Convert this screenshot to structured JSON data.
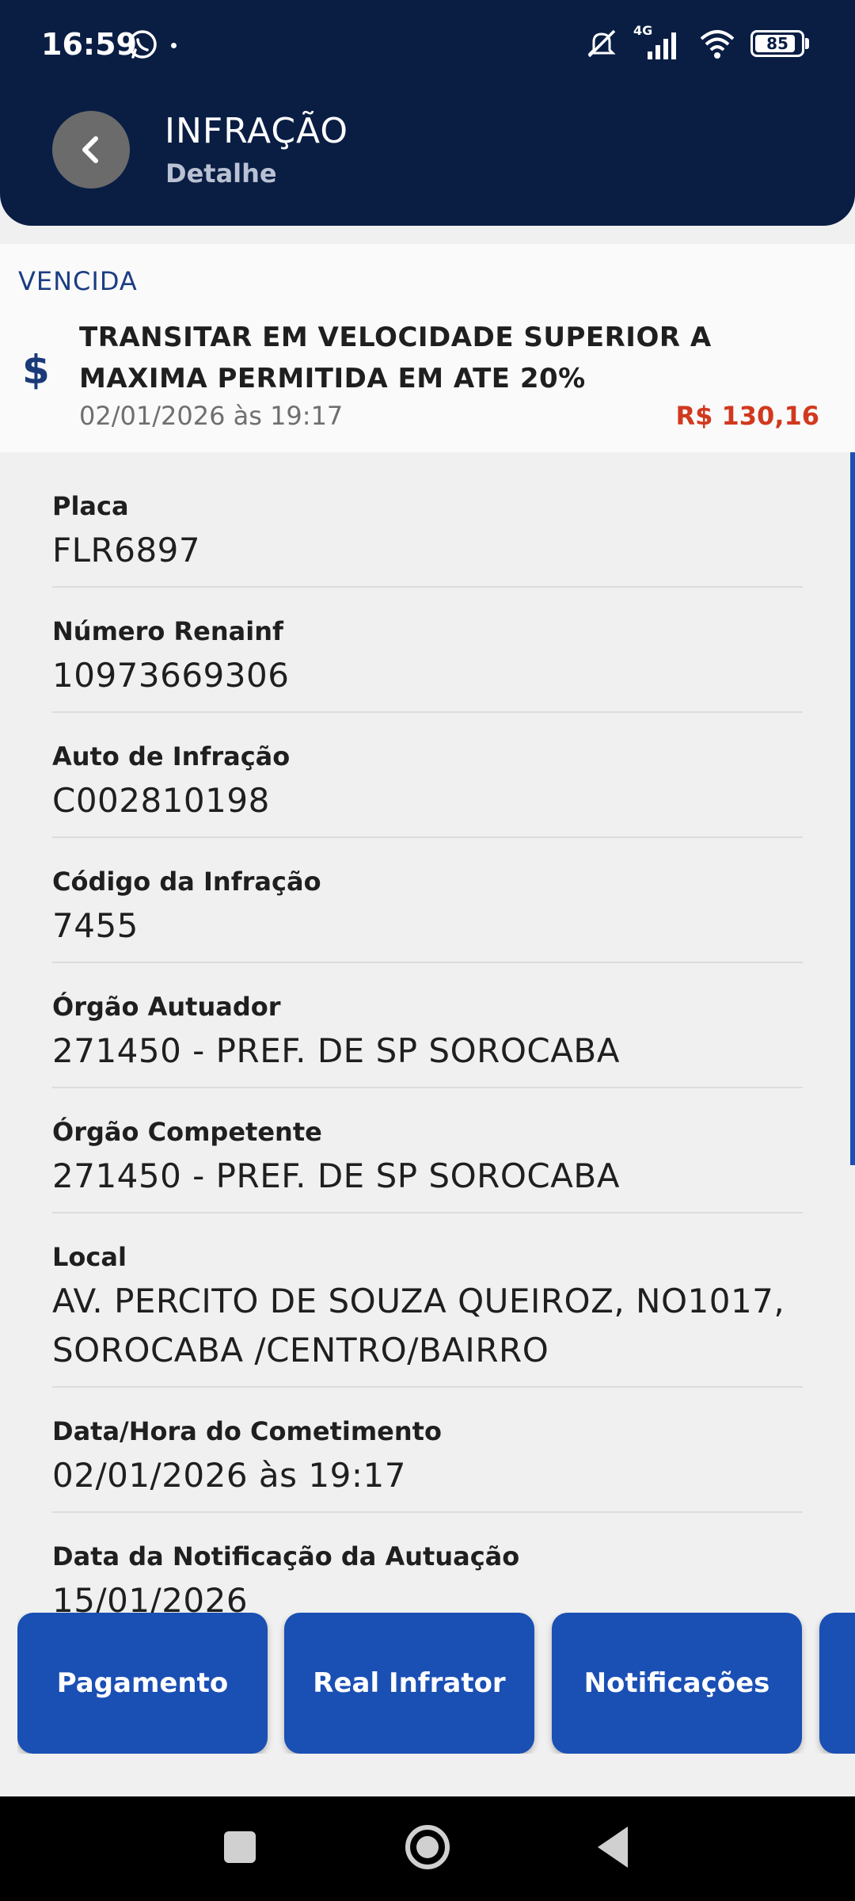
{
  "status_bar": {
    "time": "16:59",
    "network": "4G",
    "battery": "85"
  },
  "header": {
    "title": "INFRAÇÃO",
    "subtitle": "Detalhe"
  },
  "summary": {
    "status": "VENCIDA",
    "title": "TRANSITAR EM VELOCIDADE SUPERIOR A MAXIMA PERMITIDA EM ATE 20%",
    "datetime": "02/01/2026 às 19:17",
    "amount": "R$ 130,16",
    "amount_color": "#d1391e"
  },
  "details": [
    {
      "label": "Placa",
      "value": "FLR6897"
    },
    {
      "label": "Número Renainf",
      "value": "10973669306"
    },
    {
      "label": "Auto de Infração",
      "value": "C002810198"
    },
    {
      "label": "Código da Infração",
      "value": "7455"
    },
    {
      "label": "Órgão Autuador",
      "value": "271450 - PREF. DE SP SOROCABA"
    },
    {
      "label": "Órgão Competente",
      "value": "271450 - PREF. DE SP SOROCABA"
    },
    {
      "label": "Local",
      "value": "AV. PERCITO DE SOUZA QUEIROZ, NO1017, SOROCABA /CENTRO/BAIRRO"
    },
    {
      "label": "Data/Hora do Cometimento",
      "value": "02/01/2026 às 19:17"
    },
    {
      "label": "Data da Notificação da Autuação",
      "value": "15/01/2026"
    }
  ],
  "actions": [
    {
      "label": "Pagamento"
    },
    {
      "label": "Real Infrator"
    },
    {
      "label": "Notificações"
    },
    {
      "label": ""
    }
  ],
  "colors": {
    "header_bg": "#0a1e44",
    "accent": "#1a4fb4",
    "status_text": "#1c3d83"
  },
  "icons": [
    "whatsapp-icon",
    "mute-icon",
    "signal-icon",
    "wifi-icon",
    "battery-icon",
    "back-arrow-icon",
    "dollar-icon"
  ]
}
